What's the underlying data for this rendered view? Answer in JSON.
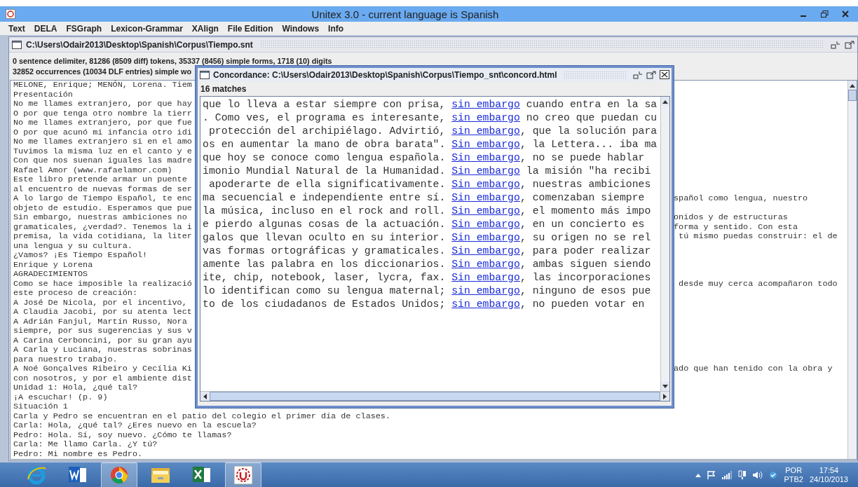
{
  "window": {
    "title": "Unitex 3.0 - current language is Spanish"
  },
  "menu": [
    "Text",
    "DELA",
    "FSGraph",
    "Lexicon-Grammar",
    "XAlign",
    "File Edition",
    "Windows",
    "Info"
  ],
  "text_frame": {
    "title": "C:\\Users\\Odair2013\\Desktop\\Spanish\\Corpus\\Tiempo.snt",
    "stats": [
      "0 sentence delimiter, 81286 (8509 diff) tokens, 35337 (8456) simple forms, 1718 (10) digits",
      "32852 occurrences (10034 DLF entries) simple wo"
    ],
    "lines": [
      {
        "left": "MELONE, Enrique; MENÓN, Lorena. Tiem"
      },
      {
        "left": "Presentación"
      },
      {
        "left": "No me llames extranjero, por que hay"
      },
      {
        "left": "O por que tenga otro nombre la tierr"
      },
      {
        "left": "No me llames extranjero, por que fue"
      },
      {
        "left": "O por que acunó mi infancia otro idi"
      },
      {
        "left": "No me llames extranjero si en el amo"
      },
      {
        "left": "Tuvimos la misma luz en el canto y e"
      },
      {
        "left": "Con que nos suenan iguales las madre"
      },
      {
        "left": "Rafael Amor (www.rafaelamor.com)"
      },
      {
        "left": "Este libro pretende armar un puente"
      },
      {
        "left": "al encuentro de nuevas formas de ser"
      },
      {
        "left": "A lo largo de Tiempo Español, te enc",
        "right": "spañol como lengua, nuestro"
      },
      {
        "left": "objeto de estudio. Esperamos que pue"
      },
      {
        "left": "Sin embargo, nuestras ambiciones no",
        "right": "onidos y de estructuras"
      },
      {
        "left": "gramaticales, ¿verdad?. Tenemos la i",
        "right": "forma y sentido. Con esta"
      },
      {
        "left": "premisa, la vida cotidiana, la liter",
        "right": " tú mismo puedas construir: el de"
      },
      {
        "left": "una lengua y su cultura."
      },
      {
        "left": "¿Vamos? ¡Es Tiempo Español!"
      },
      {
        "left": "Enrique y Lorena"
      },
      {
        "left": "AGRADECIMIENTOS"
      },
      {
        "left": "Como se hace imposible la realizació",
        "right": " desde muy cerca acompañaron todo"
      },
      {
        "left": "este proceso de creación:"
      },
      {
        "left": "A José De Nicola, por el incentivo,"
      },
      {
        "left": "A Claudia Jacobi, por su atenta lect"
      },
      {
        "left": "A Adrián Fanjul, Martín Russo, Nora"
      },
      {
        "left": "siempre, por sus sugerencias y sus v"
      },
      {
        "left": "A Carina Cerboncini, por su gran ayu"
      },
      {
        "left": "A Carla y Luciana, nuestras sobrinas"
      },
      {
        "left": "para nuestro trabajo."
      },
      {
        "left": "A Noé Gonçalves Ribeiro y Cecília Ki",
        "right": "ado que han tenido con la obra y"
      },
      {
        "left": "con nosotros, y por el ambiente dist"
      },
      {
        "left": "Unidad 1: Hola, ¿qué tal?"
      },
      {
        "left": "¡A escuchar! (p. 9)"
      },
      {
        "left": "Situación 1"
      },
      {
        "left": "Carla y Pedro se encuentran en el patio del colegio el primer día de clases."
      },
      {
        "left": "Carla: Hola, ¿qué tal? ¿Eres nuevo en la escuela?"
      },
      {
        "left": "Pedro: Hola. Sí, soy nuevo. ¿Cómo te llamas?"
      },
      {
        "left": "Carla: Me llamo Carla. ¿Y tú?"
      },
      {
        "left": "Pedro: Mi nombre es Pedro."
      }
    ]
  },
  "concordance": {
    "title": "Concordance: C:\\Users\\Odair2013\\Desktop\\Spanish\\Corpus\\Tiempo_snt\\concord.html",
    "count": "16 matches",
    "rows": [
      {
        "left": "que lo lleva a estar siempre con prisa, ",
        "match": "sin embargo",
        "right": " cuando entra en la sa"
      },
      {
        "left": ". Como ves, el programa es interesante, ",
        "match": "sin embargo",
        "right": " no creo que puedan cu"
      },
      {
        "left": " protección del archipiélago. Advirtió, ",
        "match": "sin embargo",
        "right": ", que la solución para"
      },
      {
        "left": "os en aumentar la mano de obra barata\". ",
        "match": "Sin embargo",
        "right": ", la Lettera... iba ma"
      },
      {
        "left": "que hoy se conoce como lengua española. ",
        "match": "Sin embargo",
        "right": ", no se puede hablar"
      },
      {
        "left": "imonio Mundial Natural de la Humanidad. ",
        "match": "Sin embargo",
        "right": " la misión \"ha recibi"
      },
      {
        "left": " apoderarte de ella significativamente. ",
        "match": "Sin embargo",
        "right": ", nuestras ambiciones"
      },
      {
        "left": "ma secuencial e independiente entre sí. ",
        "match": "Sin embargo",
        "right": ", comenzaban siempre"
      },
      {
        "left": "la música, incluso en el rock and roll. ",
        "match": "Sin embargo",
        "right": ", el momento más impo"
      },
      {
        "left": "e pierdo algunas cosas de la actuación. ",
        "match": "Sin embargo",
        "right": ", en un concierto es"
      },
      {
        "left": "galos que llevan oculto en su interior. ",
        "match": "Sin embargo",
        "right": ", su origen no se rel"
      },
      {
        "left": "vas formas ortográficas y gramaticales. ",
        "match": "Sin embargo",
        "right": ", para poder realizar"
      },
      {
        "left": "amente las palabra en los diccionarios. ",
        "match": "Sin embargo",
        "right": ", ambas siguen siendo"
      },
      {
        "left": "ite, chip, notebook, laser, lycra, fax. ",
        "match": "Sin embargo",
        "right": ", las incorporaciones"
      },
      {
        "left": "lo identifican como su lengua maternal; ",
        "match": "sin embargo",
        "right": ", ninguno de esos pue"
      },
      {
        "left": "to de los ciudadanos de Estados Unidos; ",
        "match": "sin embargo",
        "right": ", no pueden votar en"
      }
    ]
  },
  "taskbar": {
    "apps": [
      {
        "kind": "browser-e",
        "selected": false
      },
      {
        "kind": "word",
        "selected": false
      },
      {
        "kind": "chrome",
        "selected": true
      },
      {
        "kind": "folder",
        "selected": false
      },
      {
        "kind": "excel",
        "selected": false
      },
      {
        "kind": "unitex",
        "selected": true
      }
    ],
    "language": [
      "POR",
      "PTB2"
    ],
    "time": "17:54",
    "date": "24/10/2013"
  }
}
